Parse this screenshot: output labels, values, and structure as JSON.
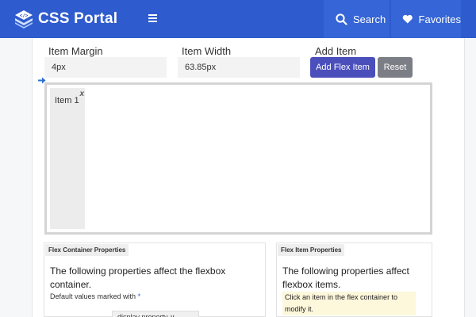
{
  "header": {
    "brand": "CSS Portal",
    "search_label": "Search",
    "favorites_label": "Favorites",
    "colors": {
      "bar": "#2e5bce",
      "tab": "#3565d6"
    },
    "icons": [
      "code-logo-icon",
      "hamburger-menu-icon",
      "search-icon",
      "heart-icon"
    ]
  },
  "controls": {
    "margin_label": "Item Margin",
    "margin_value": "4px",
    "width_label": "Item Width",
    "width_value": "63.85px",
    "add_label": "Add Item",
    "add_button": "Add Flex Item",
    "reset_button": "Reset"
  },
  "flex_container": {
    "items": [
      {
        "label": "Item 1",
        "close": "x"
      }
    ]
  },
  "container_props": {
    "title": "Flex Container Properties",
    "description": "The following properties affect the flexbox container.",
    "note": "Default values marked with",
    "note_marker": "*",
    "select_value": "display property ∨"
  },
  "item_props": {
    "title": "Flex Item Properties",
    "description": "The following properties affect flexbox items.",
    "hint": "Click an item in the flex container to modify it."
  }
}
